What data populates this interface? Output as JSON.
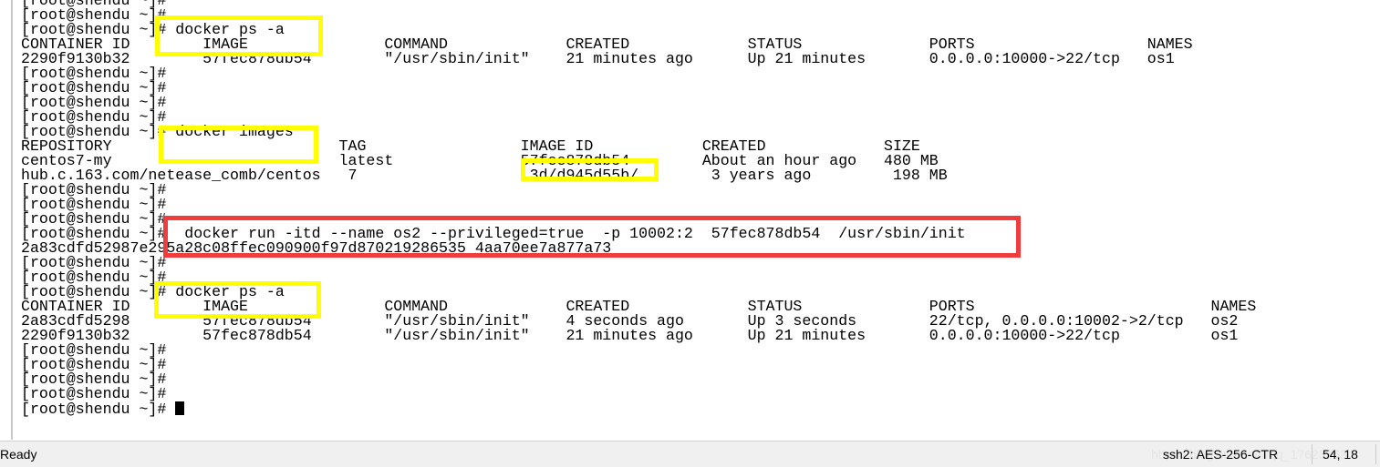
{
  "terminal": {
    "lines": [
      "[root@shendu ~]#",
      "[root@shendu ~]#",
      "[root@shendu ~]# docker ps -a",
      "CONTAINER ID        IMAGE               COMMAND             CREATED             STATUS              PORTS                   NAMES",
      "2290f9130b32        57fec878db54        \"/usr/sbin/init\"    21 minutes ago      Up 21 minutes       0.0.0.0:10000->22/tcp   os1",
      "[root@shendu ~]#",
      "[root@shendu ~]#",
      "[root@shendu ~]#",
      "[root@shendu ~]#",
      "[root@shendu ~]# docker images",
      "REPOSITORY                         TAG                 IMAGE ID            CREATED             SIZE",
      "centos7-my                         latest              57fec878db54        About an hour ago   480 MB",
      "hub.c.163.com/netease_comb/centos   7                   3d/d945d55b/        3 years ago         198 MB",
      "[root@shendu ~]#",
      "[root@shendu ~]#",
      "[root@shendu ~]#",
      "[root@shendu ~]#  docker run -itd --name os2 --privileged=true  -p 10002:2  57fec878db54  /usr/sbin/init",
      "2a83cdfd52987e295a28c08ffec090900f97d870219286535 4aa70ee7a877a73",
      "[root@shendu ~]#",
      "[root@shendu ~]#",
      "[root@shendu ~]# docker ps -a",
      "CONTAINER ID        IMAGE               COMMAND             CREATED             STATUS              PORTS                          NAMES",
      "2a83cdfd5298        57fec878db54        \"/usr/sbin/init\"    4 seconds ago       Up 3 seconds        22/tcp, 0.0.0.0:10002->2/tcp   os2",
      "2290f9130b32        57fec878db54        \"/usr/sbin/init\"    21 minutes ago      Up 21 minutes       0.0.0.0:10000->22/tcp          os1",
      "[root@shendu ~]#",
      "[root@shendu ~]#",
      "[root@shendu ~]#",
      "[root@shendu ~]#",
      "[root@shendu ~]# "
    ]
  },
  "status": {
    "ready": "Ready",
    "cipher": "ssh2: AES-256-CTR",
    "cursor_pos": "54, 18",
    "watermark": "https://blog.csdn.net/qq_17623363"
  },
  "colors": {
    "highlight": "#ffff00",
    "highlight_run": "#f03c3c"
  }
}
